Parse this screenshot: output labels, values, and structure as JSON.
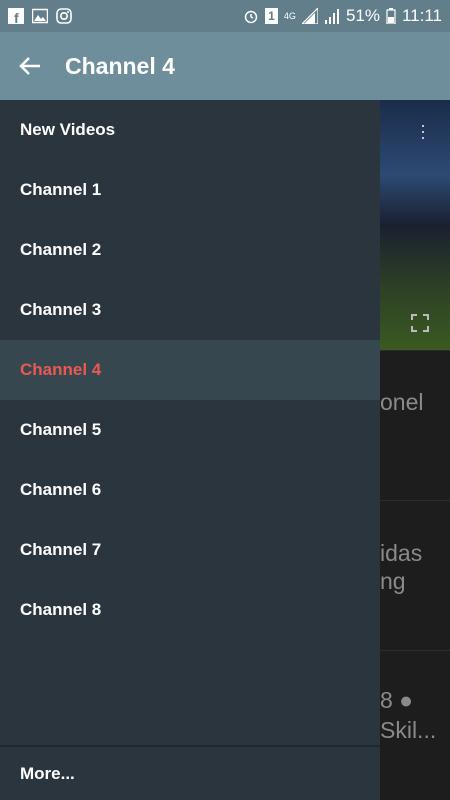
{
  "status_bar": {
    "battery": "51%",
    "time": "11:11",
    "network": "4G",
    "sim": "1",
    "icons": [
      "facebook-icon",
      "gallery-icon",
      "instagram-icon",
      "alarm-icon",
      "sim-icon",
      "signal-icon",
      "battery-icon"
    ]
  },
  "app_bar": {
    "title": "Channel 4",
    "back_icon": "arrow-left-icon"
  },
  "drawer": {
    "items": [
      {
        "label": "New Videos"
      },
      {
        "label": "Channel 1"
      },
      {
        "label": "Channel 2"
      },
      {
        "label": "Channel 3"
      },
      {
        "label": "Channel 4",
        "active": true
      },
      {
        "label": "Channel 5"
      },
      {
        "label": "Channel 6"
      },
      {
        "label": "Channel 7"
      },
      {
        "label": "Channel 8"
      }
    ],
    "footer_label": "More..."
  },
  "background": {
    "item1": "onel",
    "item2_line1": "idas",
    "item2_line2": "ng",
    "item3_line1": "8 ●",
    "item3_line2": "Skil..."
  },
  "colors": {
    "status_bar": "#627e8a",
    "app_bar": "#6f8e9b",
    "drawer_bg": "#2a353d",
    "active_bg": "#37474f",
    "active_text": "#e85a50"
  }
}
